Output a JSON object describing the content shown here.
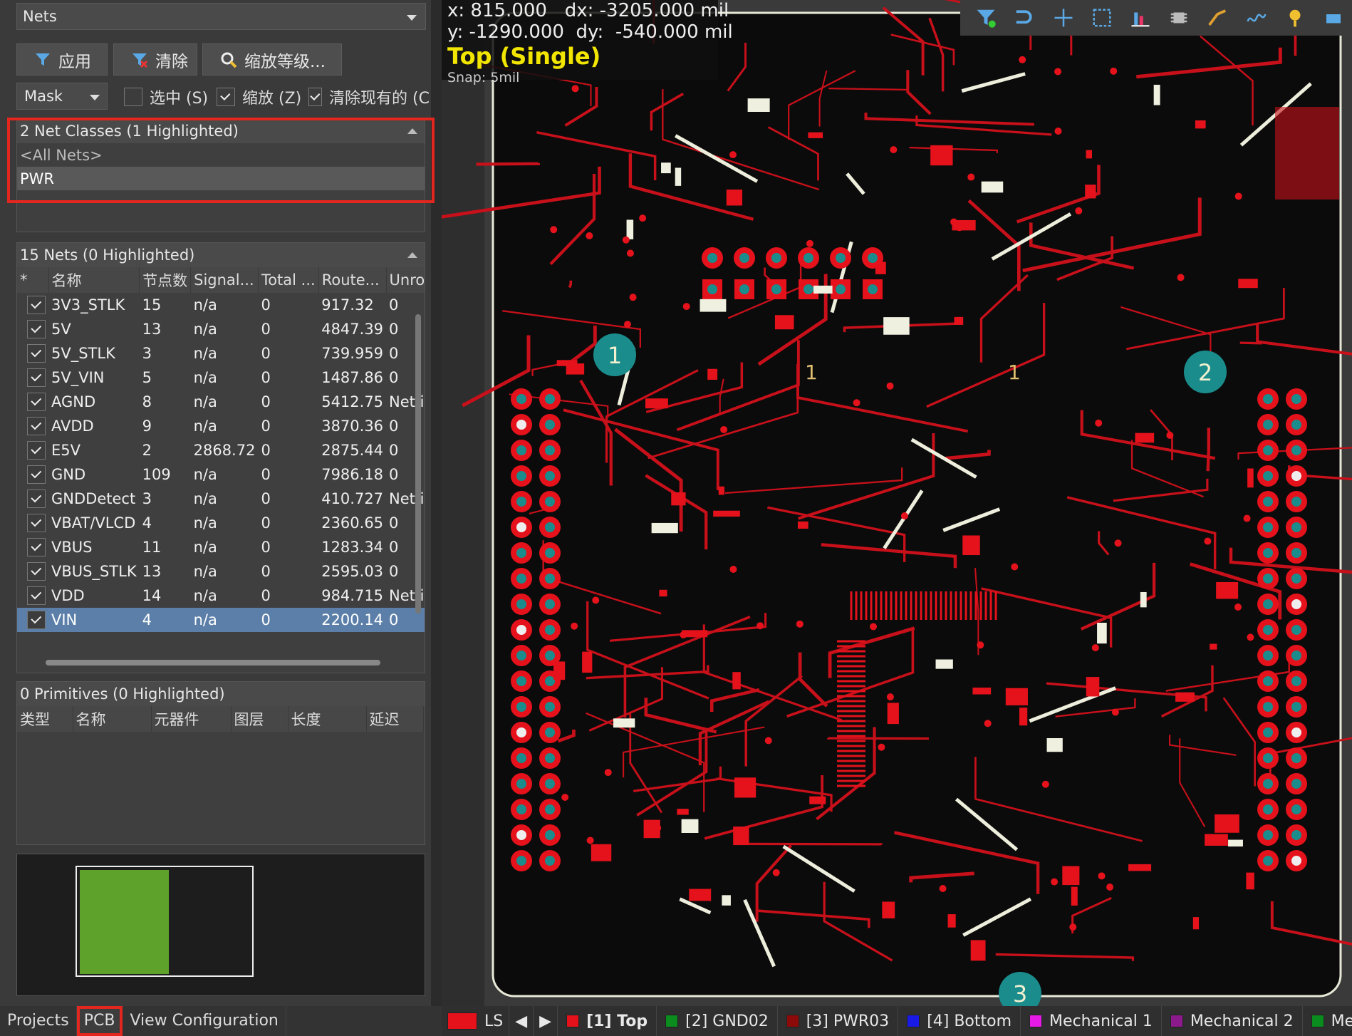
{
  "panel": {
    "mode_dropdown": "Nets",
    "buttons": {
      "apply": "应用",
      "clear": "清除",
      "zoom": "缩放等级..."
    },
    "mask": "Mask",
    "checkboxes": [
      {
        "label": "选中 (S)",
        "checked": false
      },
      {
        "label": "缩放 (Z)",
        "checked": true
      },
      {
        "label": "清除现有的 (C",
        "checked": true
      }
    ],
    "net_classes": {
      "header": "2 Net Classes (1 Highlighted)",
      "items": [
        "<All Nets>",
        "PWR"
      ]
    },
    "nets": {
      "header": "15 Nets (0 Highlighted)",
      "columns": [
        "*",
        "名称",
        "节点数",
        "Signal...",
        "Total ...",
        "Route...",
        "Unrou"
      ],
      "rows": [
        {
          "name": "3V3_STLK",
          "nodes": "15",
          "signal": "n/a",
          "total": "0",
          "route": "917.32",
          "unrouted": "0"
        },
        {
          "name": "5V",
          "nodes": "13",
          "signal": "n/a",
          "total": "0",
          "route": "4847.39",
          "unrouted": "0"
        },
        {
          "name": "5V_STLK",
          "nodes": "3",
          "signal": "n/a",
          "total": "0",
          "route": "739.959",
          "unrouted": "0"
        },
        {
          "name": "5V_VIN",
          "nodes": "5",
          "signal": "n/a",
          "total": "0",
          "route": "1487.86",
          "unrouted": "0"
        },
        {
          "name": "AGND",
          "nodes": "8",
          "signal": "n/a",
          "total": "0",
          "route": "5412.75",
          "unrouted": "Net is"
        },
        {
          "name": "AVDD",
          "nodes": "9",
          "signal": "n/a",
          "total": "0",
          "route": "3870.36",
          "unrouted": "0"
        },
        {
          "name": "E5V",
          "nodes": "2",
          "signal": "2868.72",
          "total": "0",
          "route": "2875.44",
          "unrouted": "0"
        },
        {
          "name": "GND",
          "nodes": "109",
          "signal": "n/a",
          "total": "0",
          "route": "7986.18",
          "unrouted": "0"
        },
        {
          "name": "GNDDetect",
          "nodes": "3",
          "signal": "n/a",
          "total": "0",
          "route": "410.727",
          "unrouted": "Net is"
        },
        {
          "name": "VBAT/VLCD",
          "nodes": "4",
          "signal": "n/a",
          "total": "0",
          "route": "2360.65",
          "unrouted": "0"
        },
        {
          "name": "VBUS",
          "nodes": "11",
          "signal": "n/a",
          "total": "0",
          "route": "1283.34",
          "unrouted": "0"
        },
        {
          "name": "VBUS_STLK",
          "nodes": "13",
          "signal": "n/a",
          "total": "0",
          "route": "2595.03",
          "unrouted": "0"
        },
        {
          "name": "VDD",
          "nodes": "14",
          "signal": "n/a",
          "total": "0",
          "route": "984.715",
          "unrouted": "Net is"
        },
        {
          "name": "VIN",
          "nodes": "4",
          "signal": "n/a",
          "total": "0",
          "route": "2200.14",
          "unrouted": "0"
        }
      ]
    },
    "primitives": {
      "header": "0 Primitives (0 Highlighted)",
      "columns": [
        "类型",
        "名称",
        "元器件",
        "图层",
        "长度",
        "延迟"
      ]
    },
    "tabs": [
      "Projects",
      "PCB",
      "View Configuration"
    ]
  },
  "hud": {
    "x_label": "x:",
    "x_val": "815.000",
    "dx_label": "dx:",
    "dx_val": "-3205.000",
    "unit1": "mil",
    "y_label": "y:",
    "y_val": "-1290.000",
    "dy_label": "dy:",
    "dy_val": "-540.000",
    "unit2": "mil",
    "layer": "Top (Single)",
    "snap": "Snap: 5mil"
  },
  "board_labels": [
    "1",
    "2",
    "3",
    "1",
    "1"
  ],
  "layerbar": {
    "ls": "LS",
    "layers": [
      {
        "label": "[1] Top",
        "color": "#e5121c",
        "bold": true
      },
      {
        "label": "[2] GND02",
        "color": "#0a8c1e",
        "bold": false
      },
      {
        "label": "[3] PWR03",
        "color": "#8c0a0a",
        "bold": false
      },
      {
        "label": "[4] Bottom",
        "color": "#1a1ae6",
        "bold": false
      },
      {
        "label": "Mechanical 1",
        "color": "#e61ae6",
        "bold": false
      },
      {
        "label": "Mechanical 2",
        "color": "#8c1a8c",
        "bold": false
      },
      {
        "label": "Mec",
        "color": "#0a8c1e",
        "bold": false
      }
    ]
  },
  "colors": {
    "copper": "#e5121c",
    "pad_teal": "#1a8c8c",
    "board_bg": "#0a0a0a",
    "silk": "#f0f0e0"
  }
}
